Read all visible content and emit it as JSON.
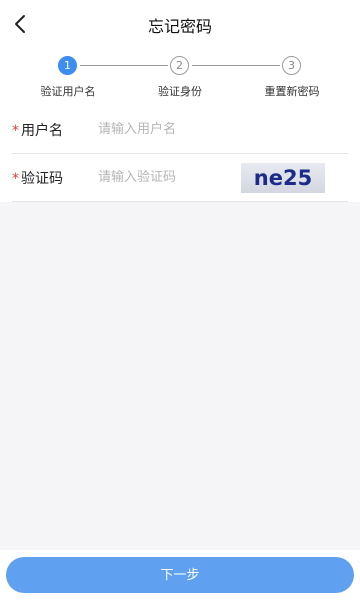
{
  "header": {
    "title": "忘记密码",
    "back_icon": "chevron-left-icon"
  },
  "steps": [
    {
      "number": "1",
      "label": "验证用户名",
      "state": "active"
    },
    {
      "number": "2",
      "label": "验证身份",
      "state": "inactive"
    },
    {
      "number": "3",
      "label": "重置新密码",
      "state": "inactive"
    }
  ],
  "form": {
    "username": {
      "required_mark": "*",
      "label": "用户名",
      "value": "",
      "placeholder": "请输入用户名"
    },
    "captcha": {
      "required_mark": "*",
      "label": "验证码",
      "value": "",
      "placeholder": "请输入验证码",
      "image_text": "ne25"
    }
  },
  "actions": {
    "next_label": "下一步"
  },
  "colors": {
    "accent": "#3d8ef0",
    "button": "#5fa0f0",
    "required": "#e23b3b",
    "background": "#f5f5f7"
  }
}
